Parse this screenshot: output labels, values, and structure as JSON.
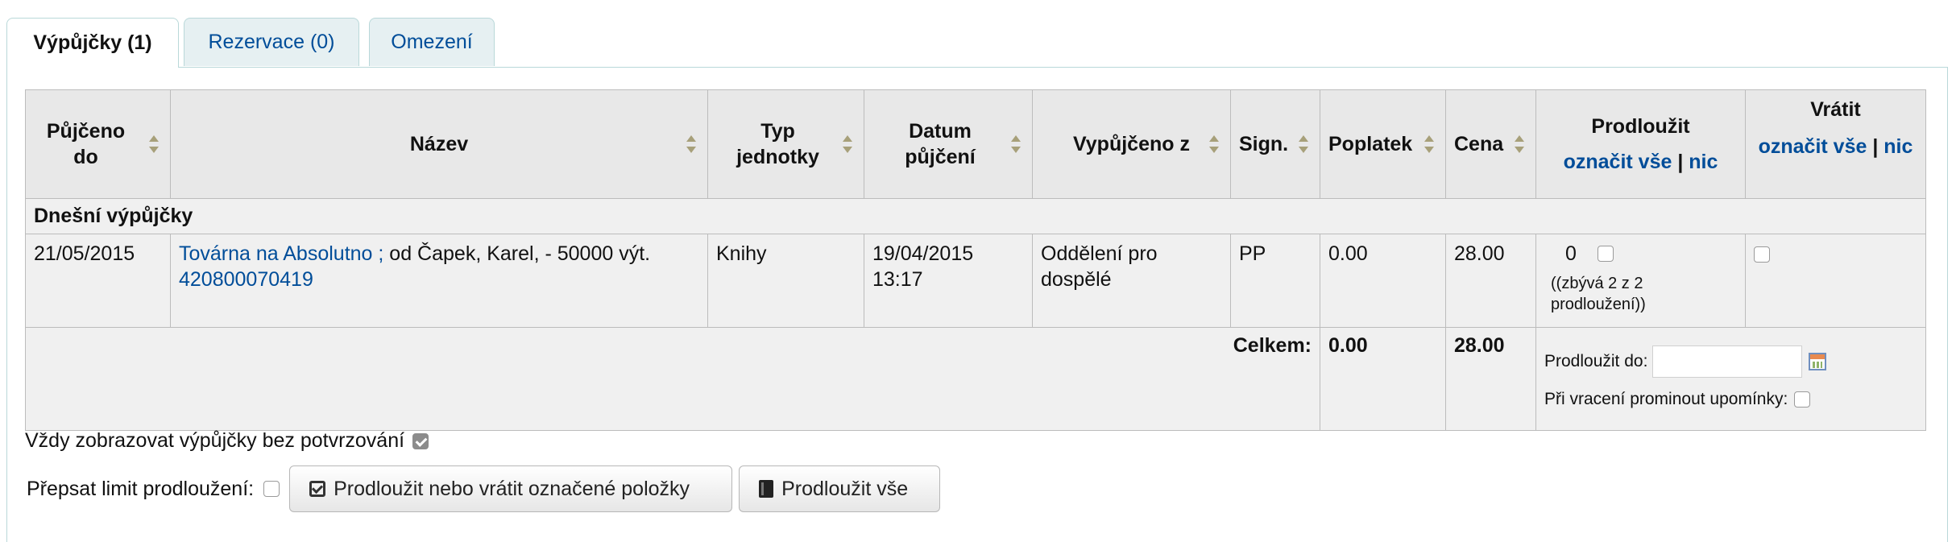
{
  "tabs": [
    {
      "label": "Výpůjčky (1)",
      "active": true
    },
    {
      "label": "Rezervace (0)",
      "active": false
    },
    {
      "label": "Omezení",
      "active": false
    }
  ],
  "table": {
    "headers": {
      "due": "Půjčeno do",
      "title": "Název",
      "itemtype": "Typ jednotky",
      "issuedate": "Datum půjčení",
      "branch": "Vypůjčeno z",
      "callno": "Sign.",
      "charge": "Poplatek",
      "price": "Cena",
      "renew": "Prodloužit",
      "return": "Vrátit",
      "select_all": "označit vše",
      "select_none": "nic",
      "separator": "|"
    },
    "group_label": "Dnešní výpůjčky",
    "row": {
      "due": "21/05/2015",
      "title_link": "Továrna na Absolutno ;",
      "title_rest": " od Čapek, Karel, - 50000 výt.",
      "barcode": "420800070419",
      "itemtype": "Knihy",
      "issuedate": "19/04/2015 13:17",
      "branch": "Oddělení pro dospělé",
      "callno": "PP",
      "charge": "0.00",
      "price": "28.00",
      "renew_count": "0",
      "renew_note": "((zbývá 2 z 2 prodloužení))"
    },
    "totals": {
      "label": "Celkem:",
      "charge": "0.00",
      "price": "28.00",
      "renew_until_label": "Prodloužit do:",
      "renew_until_value": "",
      "skip_reminders_label": "Při vracení prominout upomínky:"
    }
  },
  "options": {
    "always_show_label": "Vždy zobrazovat výpůjčky bez potvrzování",
    "always_show_checked": true,
    "override_limit_label": "Přepsat limit prodloužení:"
  },
  "buttons": {
    "renew_or_return": "Prodloužit nebo vrátit označené položky",
    "renew_all": "Prodloužit vše"
  },
  "colors": {
    "link": "#004d99",
    "header_bg": "#e8e8e8",
    "row_bg": "#f0f0f0",
    "tab_bg": "#e6f0f2"
  }
}
